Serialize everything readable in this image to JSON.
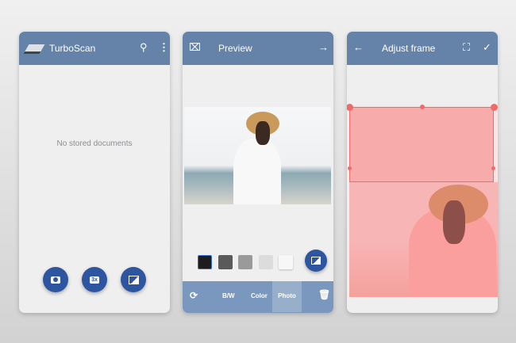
{
  "screen1": {
    "title": "TurboScan",
    "empty_text": "No stored documents",
    "icons": [
      "scanner-logo-icon",
      "search-icon",
      "more-icon",
      "camera-icon",
      "multi-scan-3x-icon",
      "gallery-icon"
    ],
    "multi_label": "3x"
  },
  "screen2": {
    "title": "Preview",
    "icons": [
      "crop-icon",
      "arrow-right-icon",
      "rotate-icon",
      "gallery-icon",
      "trash-icon"
    ],
    "modes": [
      "B/W",
      "Color",
      "Photo"
    ],
    "selected_mode": "Photo",
    "swatches": [
      "#1d1d1d",
      "#5a5a5a",
      "#9a9a9a",
      "#dcdcdc",
      "#f7f7f7"
    ]
  },
  "screen3": {
    "title": "Adjust frame",
    "icons": [
      "back-arrow-icon",
      "fullscreen-icon",
      "check-icon"
    ]
  },
  "colors": {
    "header": "#6582a8",
    "fab": "#2e56a0",
    "bottom_bar": "#7a97bd",
    "overlay": "#f47c7c"
  }
}
